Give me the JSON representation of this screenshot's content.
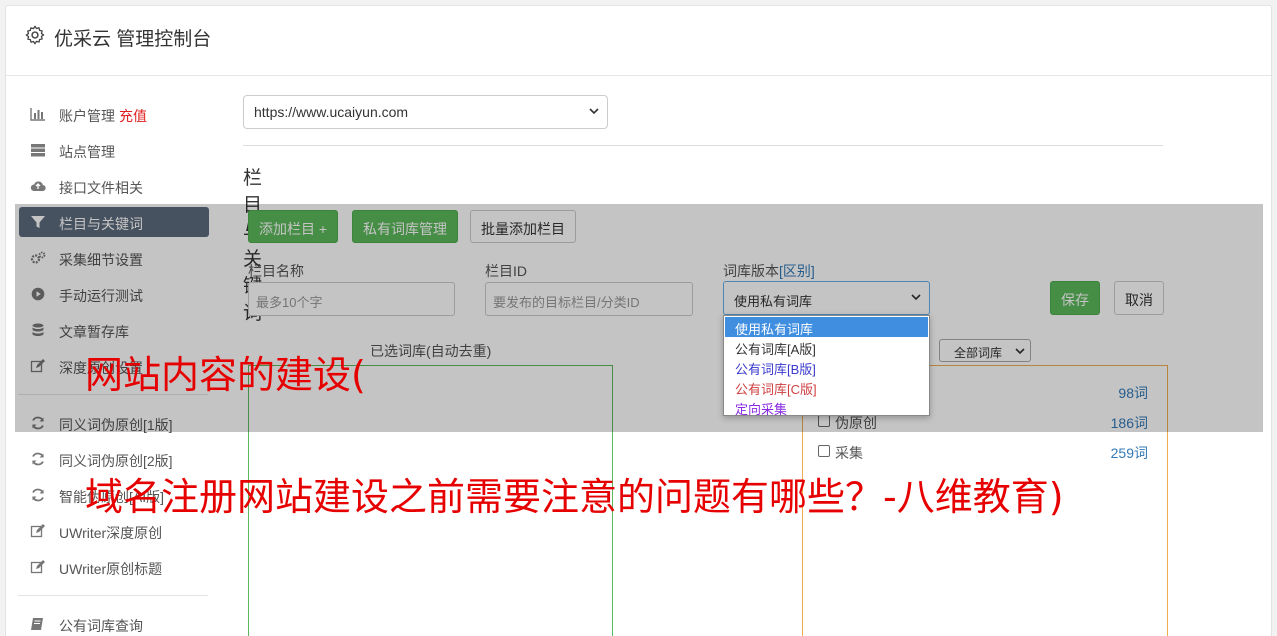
{
  "header": {
    "title": "优采云 管理控制台"
  },
  "sidebar": {
    "items": [
      {
        "label": "账户管理",
        "extra": "充值",
        "icon": "bar-chart-icon"
      },
      {
        "label": "站点管理",
        "icon": "server-icon"
      },
      {
        "label": "接口文件相关",
        "icon": "cloud-upload-icon"
      },
      {
        "label": "栏目与关键词",
        "icon": "filter-icon",
        "active": true
      },
      {
        "label": "采集细节设置",
        "icon": "cogs-icon"
      },
      {
        "label": "手动运行测试",
        "icon": "play-circle-icon"
      },
      {
        "label": "文章暂存库",
        "icon": "database-icon"
      },
      {
        "label": "深度原创设置",
        "icon": "edit-icon"
      },
      {
        "label": "同义词伪原创[1版]",
        "icon": "refresh-icon"
      },
      {
        "label": "同义词伪原创[2版]",
        "icon": "refresh-icon"
      },
      {
        "label": "智能伪原创[AI版]",
        "icon": "refresh-icon"
      },
      {
        "label": "UWriter深度原创",
        "icon": "edit-icon"
      },
      {
        "label": "UWriter原创标题",
        "icon": "edit-icon"
      },
      {
        "label": "公有词库查询",
        "icon": "book-icon"
      }
    ]
  },
  "main": {
    "site_select": "https://www.ucaiyun.com",
    "section_title": "栏目与关键词",
    "buttons": {
      "add_column": "添加栏目 +",
      "private_lib": "私有词库管理",
      "bulk_add": "批量添加栏目"
    },
    "fields": {
      "name_label": "栏目名称",
      "name_placeholder": "最多10个字",
      "id_label": "栏目ID",
      "id_placeholder": "要发布的目标栏目/分类ID",
      "lib_label": "词库版本",
      "lib_label_link": "[区别]",
      "lib_value": "使用私有词库"
    },
    "dropdown_options": [
      {
        "label": "使用私有词库",
        "color": "#ffffff"
      },
      {
        "label": "公有词库[A版]",
        "color": "#333333"
      },
      {
        "label": "公有词库[B版]",
        "color": "#3a3ad0"
      },
      {
        "label": "公有词库[C版]",
        "color": "#d04040"
      },
      {
        "label": "定向采集",
        "color": "#8a2be2"
      }
    ],
    "save_label": "保存",
    "cancel_label": "取消",
    "selected_lib_label": "已选词库(自动去重)",
    "all_lib_select": "全部词库",
    "word_rows": [
      {
        "name": "",
        "count": "98词"
      },
      {
        "name": "伪原创",
        "count": "186词"
      },
      {
        "name": "采集",
        "count": "259词"
      }
    ]
  },
  "watermark": {
    "line1": "网站内容的建设(",
    "line2": "域名注册网站建设之前需要注意的问题有哪些？-八维教育)"
  },
  "colors": {
    "accent_green": "#5cb85c",
    "active_nav": "#5d6b7e",
    "watermark": "#e60000",
    "link": "#337ab7"
  }
}
